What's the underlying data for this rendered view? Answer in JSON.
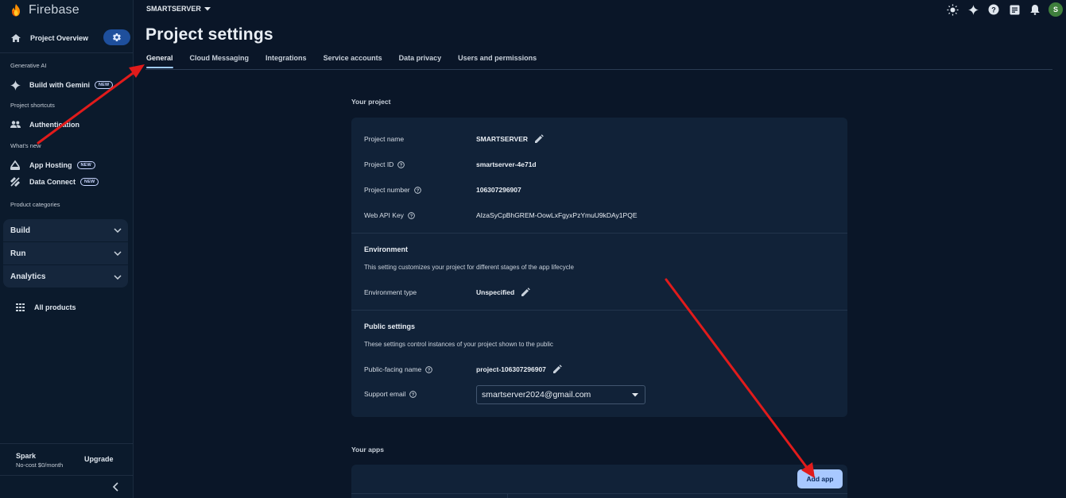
{
  "sidebar": {
    "brand": "Firebase",
    "overview_label": "Project Overview",
    "sections": {
      "generative_ai": "Generative AI",
      "shortcuts": "Project shortcuts",
      "whats_new": "What's new",
      "categories": "Product categories"
    },
    "gemini_label": "Build with Gemini",
    "auth_label": "Authentication",
    "hosting_label": "App Hosting",
    "dataconnect_label": "Data Connect",
    "new_badge": "NEW",
    "categories": [
      "Build",
      "Run",
      "Analytics"
    ],
    "all_products": "All products",
    "plan_name": "Spark",
    "plan_desc": "No-cost $0/month",
    "upgrade_label": "Upgrade"
  },
  "topbar": {
    "project": "SMARTSERVER",
    "avatar_letter": "S",
    "icons": [
      "theme-icon",
      "gemini-icon",
      "help-icon",
      "notes-icon",
      "bell-icon"
    ]
  },
  "page": {
    "title": "Project settings",
    "tabs": [
      "General",
      "Cloud Messaging",
      "Integrations",
      "Service accounts",
      "Data privacy",
      "Users and permissions"
    ]
  },
  "your_project": {
    "heading": "Your project",
    "rows": [
      {
        "label": "Project name",
        "value": "SMARTSERVER"
      },
      {
        "label": "Project ID",
        "value": "smartserver-4e71d"
      },
      {
        "label": "Project number",
        "value": "106307296907"
      },
      {
        "label": "Web API Key",
        "value": "AIzaSyCpBhGREM-OowLxFgyxPzYmuU9kDAy1PQE"
      }
    ],
    "environment": {
      "heading": "Environment",
      "desc": "This setting customizes your project for different stages of the app lifecycle",
      "type_label": "Environment type",
      "type_value": "Unspecified"
    },
    "public_settings": {
      "heading": "Public settings",
      "desc": "These settings control instances of your project shown to the public",
      "public_name_label": "Public-facing name",
      "public_name_value": "project-106307296907",
      "support_email_label": "Support email",
      "support_email_value": "smartserver2024@gmail.com"
    }
  },
  "your_apps": {
    "heading": "Your apps",
    "add_app_label": "Add app"
  },
  "colors": {
    "background": "#0a1628",
    "card": "#112238",
    "accent": "#a8c8ff",
    "annotation_arrow": "#e11b1b"
  }
}
